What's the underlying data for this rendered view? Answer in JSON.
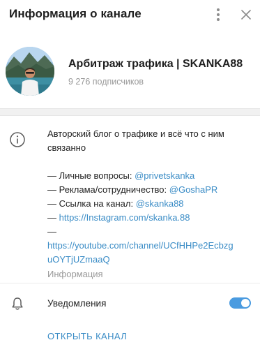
{
  "header": {
    "title": "Информация о канале",
    "more_icon": "more-vertical-icon",
    "close_icon": "close-icon"
  },
  "channel": {
    "name": "Арбитраж трафика | SKANKA88",
    "subscribers": "9 276 подписчиков"
  },
  "info": {
    "description_line1": "Авторский блог о трафике и всё что с ним",
    "description_line2": "связанно",
    "personal_prefix": "— Личные вопросы: ",
    "personal_link": "@privetskanka",
    "ads_prefix": "— Реклама/сотрудничество: ",
    "ads_link": "@GoshaPR",
    "channel_prefix": "— Ссылка на канал: ",
    "channel_link": "@skanka88",
    "instagram_prefix": "— ",
    "instagram_link": "https://Instagram.com/skanka.88",
    "youtube_prefix": "—",
    "youtube_link_line1": "https://youtube.com/channel/UCfHHPe2Ecbzg",
    "youtube_link_line2": "uOYTjUZmaaQ",
    "caption": "Информация"
  },
  "notifications": {
    "label": "Уведомления",
    "enabled": true
  },
  "actions": {
    "open_channel": "ОТКРЫТЬ КАНАЛ"
  },
  "colors": {
    "accent": "#3a8cc6",
    "toggle_on": "#4a9be0",
    "muted_text": "#999999"
  }
}
